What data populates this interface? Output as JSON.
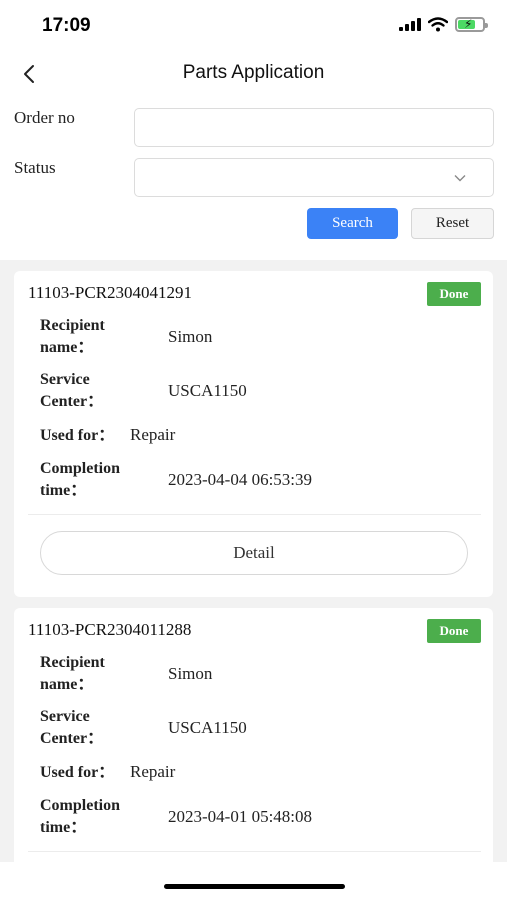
{
  "status_bar": {
    "time": "17:09"
  },
  "header": {
    "title": "Parts Application"
  },
  "filter": {
    "order_no_label": "Order no",
    "order_no_value": "",
    "status_label": "Status",
    "status_value": "",
    "search_label": "Search",
    "reset_label": "Reset"
  },
  "records": [
    {
      "order_no": "11103-PCR2304041291",
      "status": "Done",
      "recipient_label_1": "Recipient",
      "recipient_label_2": "name：",
      "recipient": "Simon",
      "service_label_1": "Service",
      "service_label_2": "Center：",
      "service_center": "USCA1150",
      "used_for_label": "Used for：",
      "used_for": "Repair",
      "completion_label_1": "Completion",
      "completion_label_2": "time：",
      "completion_time": "2023-04-04 06:53:39",
      "detail_label": "Detail"
    },
    {
      "order_no": "11103-PCR2304011288",
      "status": "Done",
      "recipient_label_1": "Recipient",
      "recipient_label_2": "name：",
      "recipient": "Simon",
      "service_label_1": "Service",
      "service_label_2": "Center：",
      "service_center": "USCA1150",
      "used_for_label": "Used for：",
      "used_for": "Repair",
      "completion_label_1": "Completion",
      "completion_label_2": "time：",
      "completion_time": "2023-04-01 05:48:08"
    }
  ],
  "colors": {
    "primary": "#3b82f6",
    "done": "#4cae4c",
    "battery": "#4cd964"
  },
  "icons": [
    "back-arrow-icon",
    "chevron-down-icon",
    "signal-icon",
    "wifi-icon",
    "battery-icon"
  ]
}
